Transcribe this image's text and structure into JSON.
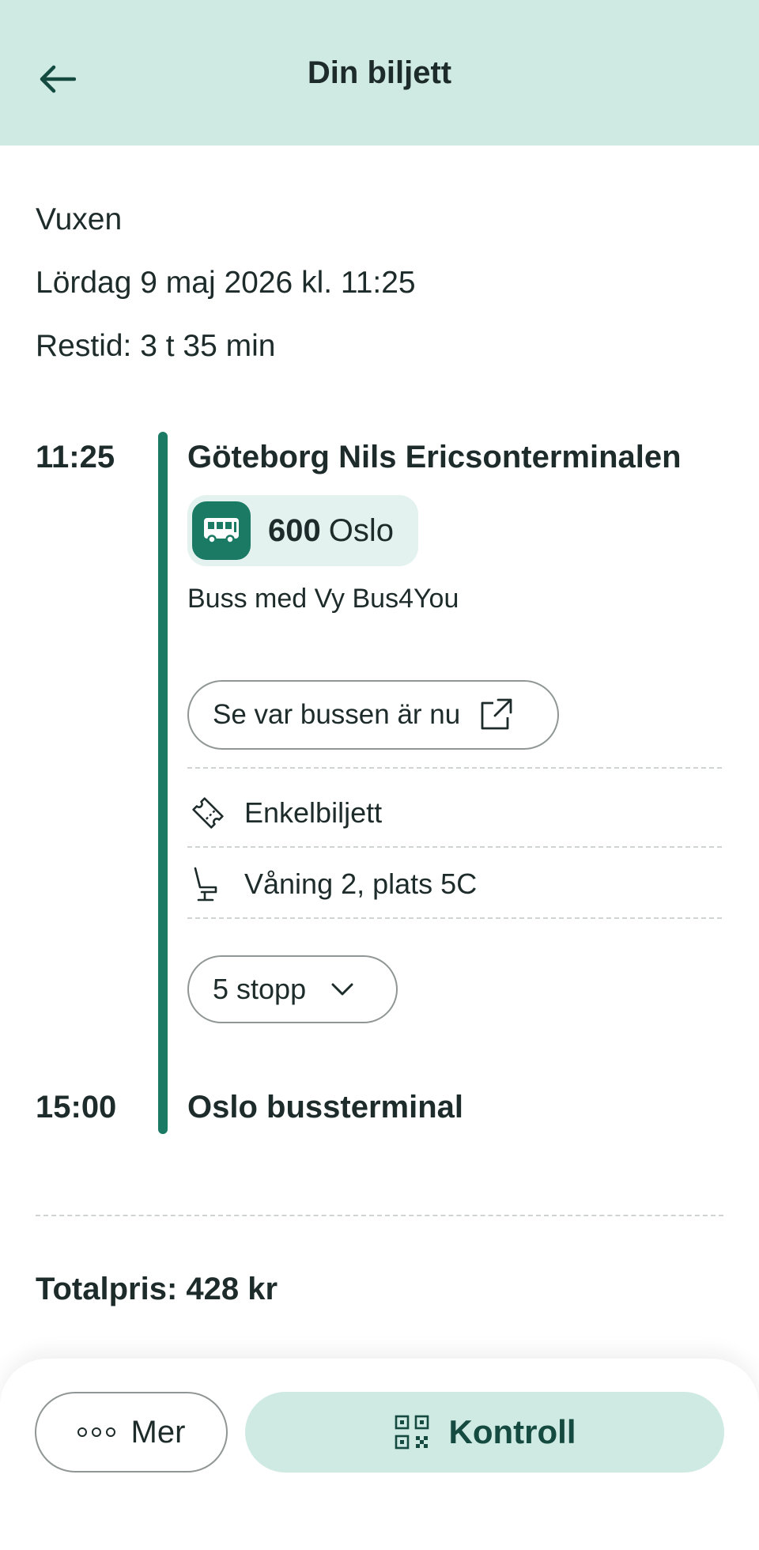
{
  "header": {
    "title": "Din biljett",
    "back_icon": "arrow-left-icon"
  },
  "ticket": {
    "passenger_type": "Vuxen",
    "date_time": "Lördag 9 maj 2026 kl. 11:25",
    "duration": "Restid: 3 t 35 min"
  },
  "journey": {
    "departure": {
      "time": "11:25",
      "stop": "Göteborg Nils Ericsonterminalen"
    },
    "line": {
      "number": "600",
      "destination": "Oslo",
      "icon": "bus-icon"
    },
    "operator": "Buss med Vy Bus4You",
    "live_button": {
      "label": "Se var bussen är nu",
      "icon": "external-link-icon"
    },
    "details": [
      {
        "icon": "ticket-icon",
        "label": "Enkelbiljett"
      },
      {
        "icon": "seat-icon",
        "label": "Våning 2, plats 5C"
      }
    ],
    "stops_button": {
      "label": "5 stopp",
      "icon": "chevron-down-icon"
    },
    "arrival": {
      "time": "15:00",
      "stop": "Oslo bussterminal"
    }
  },
  "total_price": "Totalpris: 428 kr",
  "bottom": {
    "more_label": "Mer",
    "control_label": "Kontroll",
    "control_icon": "qr-code-icon"
  },
  "colors": {
    "header_bg": "#cfe9e3",
    "accent": "#1a7a64",
    "chip_bg": "#e3f2ef"
  }
}
